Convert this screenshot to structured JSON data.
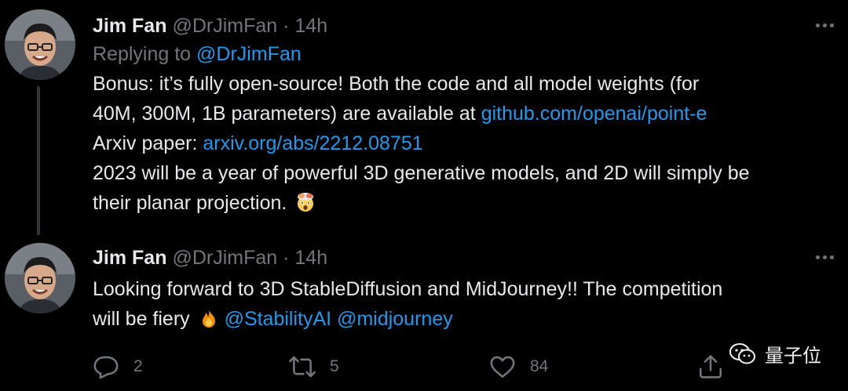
{
  "tweets": [
    {
      "name": "Jim Fan",
      "handle": "@DrJimFan",
      "sep": "·",
      "time": "14h",
      "replying_prefix": "Replying to ",
      "replying_handle": "@DrJimFan",
      "lines": {
        "l1": "Bonus: it’s fully open-source! Both the code and all model weights (for",
        "l2_text": "40M, 300M, 1B parameters) are available at ",
        "l2_link": "github.com/openai/point-e",
        "l3_text": "Arxiv paper: ",
        "l3_link": "arxiv.org/abs/2212.08751",
        "l4": "2023 will be a year of powerful 3D generative models, and 2D will simply be",
        "l5": "their planar projection."
      },
      "emoji": "exploding-head-emoji"
    },
    {
      "name": "Jim Fan",
      "handle": "@DrJimFan",
      "sep": "·",
      "time": "14h",
      "lines": {
        "l1": "Looking forward to 3D StableDiffusion and MidJourney!! The competition",
        "l2_text": "will be fiery",
        "l2_link1": "@StabilityAI",
        "l2_link2": "@midjourney"
      },
      "emoji": "fire-emoji",
      "actions": {
        "reply_count": "2",
        "retweet_count": "5",
        "like_count": "84"
      }
    }
  ],
  "watermark": {
    "label": "量子位"
  },
  "colors": {
    "background": "#000000",
    "text": "#e7e9ea",
    "muted": "#71767b",
    "link": "#1d9bf0"
  }
}
